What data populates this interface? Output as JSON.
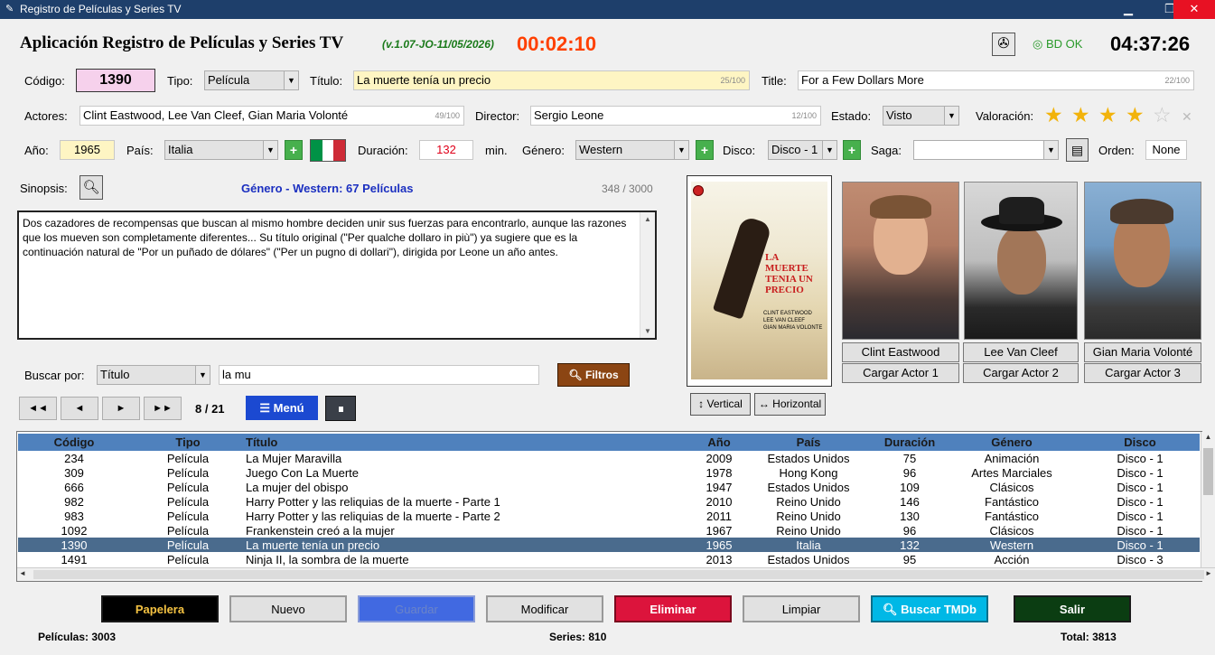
{
  "window": {
    "title": "Registro de Películas y Series TV",
    "min": "▁",
    "max": "❐",
    "close": "✕"
  },
  "header": {
    "title": "Aplicación Registro de Películas y Series TV",
    "version": "(v.1.07-JO-11/05/2026)",
    "timer": "00:02:10",
    "db_status": "◎ BD OK",
    "clock": "04:37:26"
  },
  "form": {
    "codigo_label": "Código:",
    "codigo": "1390",
    "tipo_label": "Tipo:",
    "tipo": "Película",
    "titulo_label": "Título:",
    "titulo": "La muerte tenía un precio",
    "titulo_count": "25/100",
    "title_label": "Title:",
    "title": "For a Few Dollars More",
    "title_count": "22/100",
    "actores_label": "Actores:",
    "actores": "Clint Eastwood, Lee Van Cleef, Gian Maria Volonté",
    "actores_count": "49/100",
    "director_label": "Director:",
    "director": "Sergio Leone",
    "director_count": "12/100",
    "estado_label": "Estado:",
    "estado": "Visto",
    "valoracion_label": "Valoración:",
    "rating": 4,
    "rating_max": 5,
    "clear_rating": "✕",
    "anio_label": "Año:",
    "anio": "1965",
    "pais_label": "País:",
    "pais": "Italia",
    "plus": "+",
    "duracion_label": "Duración:",
    "duracion": "132",
    "min_label": "min.",
    "genero_label": "Género:",
    "genero": "Western",
    "disco_label": "Disco:",
    "disco": "Disco - 1",
    "saga_label": "Saga:",
    "saga": "",
    "orden_label": "Orden:",
    "orden": "None"
  },
  "synopsis": {
    "label": "Sinopsis:",
    "genre_summary": "Género - Western: 67 Películas",
    "count": "348 / 3000",
    "text": "Dos cazadores de recompensas que buscan al mismo hombre deciden unir sus fuerzas para encontrarlo, aunque las razones que los mueven son completamente diferentes... Su título original (\"Per qualche dollaro in più\") ya sugiere que es la continuación natural de \"Por un puñado de dólares\" (\"Per un pugno di dollari\"), dirigida por Leone un año antes."
  },
  "search": {
    "label": "Buscar por:",
    "field": "Título",
    "query": "la mu",
    "filter_button": "Filtros"
  },
  "nav": {
    "first": "◄◄",
    "prev": "◄",
    "next": "►",
    "last": "►►",
    "position": "8 / 21",
    "menu": "☰ Menú"
  },
  "poster": {
    "title_text": "LA MUERTE TENIA UN PRECIO",
    "credits": "CLINT EASTWOOD\nLEE VAN CLEEF\nGIAN MARIA VOLONTE",
    "vertical": "↕ Vertical",
    "horizontal": "↔ Horizontal"
  },
  "actors": [
    {
      "name": "Clint Eastwood",
      "load": "Cargar Actor 1"
    },
    {
      "name": "Lee Van Cleef",
      "load": "Cargar Actor 2"
    },
    {
      "name": "Gian Maria Volonté",
      "load": "Cargar Actor 3"
    }
  ],
  "table": {
    "headers": [
      "Código",
      "Tipo",
      "Título",
      "Año",
      "País",
      "Duración",
      "Género",
      "Disco"
    ],
    "rows": [
      [
        "234",
        "Película",
        "La Mujer Maravilla",
        "2009",
        "Estados Unidos",
        "75",
        "Animación",
        "Disco - 1"
      ],
      [
        "309",
        "Película",
        "Juego Con La Muerte",
        "1978",
        "Hong Kong",
        "96",
        "Artes Marciales",
        "Disco - 1"
      ],
      [
        "666",
        "Película",
        "La mujer del obispo",
        "1947",
        "Estados Unidos",
        "109",
        "Clásicos",
        "Disco - 1"
      ],
      [
        "982",
        "Película",
        "Harry Potter y las reliquias de la muerte - Parte 1",
        "2010",
        "Reino Unido",
        "146",
        "Fantástico",
        "Disco - 1"
      ],
      [
        "983",
        "Película",
        "Harry Potter y las reliquias de la muerte - Parte 2",
        "2011",
        "Reino Unido",
        "130",
        "Fantástico",
        "Disco - 1"
      ],
      [
        "1092",
        "Película",
        "Frankenstein creó a la mujer",
        "1967",
        "Reino Unido",
        "96",
        "Clásicos",
        "Disco - 1"
      ],
      [
        "1390",
        "Película",
        "La muerte tenía un precio",
        "1965",
        "Italia",
        "132",
        "Western",
        "Disco - 1"
      ],
      [
        "1491",
        "Película",
        "Ninja II, la sombra de la muerte",
        "2013",
        "Estados Unidos",
        "95",
        "Acción",
        "Disco - 3"
      ]
    ],
    "selected_index": 6
  },
  "buttons": {
    "papelera": "Papelera",
    "nuevo": "Nuevo",
    "guardar": "Guardar",
    "modificar": "Modificar",
    "eliminar": "Eliminar",
    "limpiar": "Limpiar",
    "buscar_tmdb": "Buscar TMDb",
    "salir": "Salir"
  },
  "footer": {
    "peliculas": "Películas: 3003",
    "series": "Series: 810",
    "total": "Total: 3813"
  },
  "colors": {
    "accent_blue": "#1b49d1",
    "timer_red": "#ff4000",
    "version_green": "#1a7a1a",
    "star": "#f2b30b",
    "header_row": "#4f81bd",
    "selected_row": "#4a6b8d"
  }
}
